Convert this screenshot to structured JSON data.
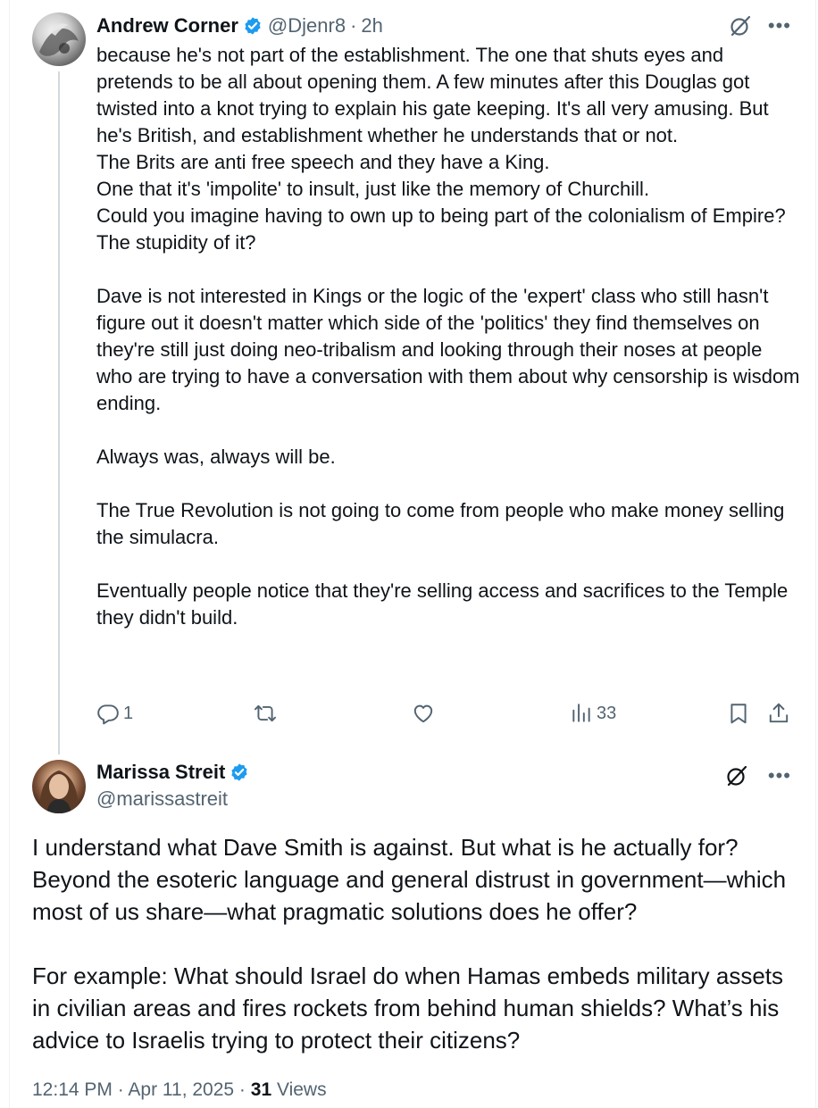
{
  "reply_tweet": {
    "author_name": "Andrew Corner",
    "handle": "@Djenr8",
    "separator": "·",
    "time": "2h",
    "paragraphs": [
      [
        "because he's not part of the establishment. The one that shuts eyes and pretends to be all about opening them.  A few minutes after this Douglas got twisted into a knot trying to explain his gate keeping. It's all very amusing. But he's British, and establishment whether he understands that or not.",
        "The Brits are anti free speech and they have a King.",
        "One that it's 'impolite' to insult, just like the memory of Churchill.",
        "Could you imagine having to own up to being part of the colonialism of Empire?",
        "The stupidity of it?"
      ],
      [
        "Dave is not interested in Kings or the logic of the 'expert' class who still hasn't figure out it doesn't matter which side of the 'politics' they find themselves on they're still just doing neo-tribalism and looking through their noses at people who are trying to have a conversation with them about why censorship is wisdom ending."
      ],
      [
        "Always was, always will be."
      ],
      [
        "The True Revolution is not going to come from people who make money selling the simulacra."
      ],
      [
        "Eventually people notice that they're selling access and sacrifices to the Temple they didn't build."
      ]
    ],
    "actions": {
      "reply_count": "1",
      "repost_count": "",
      "like_count": "",
      "views_count": "33"
    }
  },
  "main_tweet": {
    "author_name": "Marissa Streit",
    "handle": "@marissastreit",
    "paragraphs": [
      "I understand what Dave Smith is against. But what is he actually for? Beyond the esoteric language and general distrust in government—which most of us share—what pragmatic solutions does he offer?",
      "For example: What should Israel do when Hamas embeds military assets in civilian areas and fires rockets from behind human shields? What’s his advice to Israelis trying to protect their citizens?"
    ],
    "timestamp": "12:14 PM · Apr 11, 2025 · ",
    "views_count": "31",
    "views_label": " Views"
  },
  "icons": {
    "verified": "verified-badge-icon",
    "grok": "grok-icon",
    "more": "more-icon",
    "reply": "reply-icon",
    "repost": "repost-icon",
    "like": "like-icon",
    "views": "views-icon",
    "bookmark": "bookmark-icon",
    "share": "share-icon"
  },
  "colors": {
    "text": "#0f1419",
    "secondary": "#536471",
    "verified": "#1d9bf0",
    "thread_line": "#cfd9de"
  }
}
